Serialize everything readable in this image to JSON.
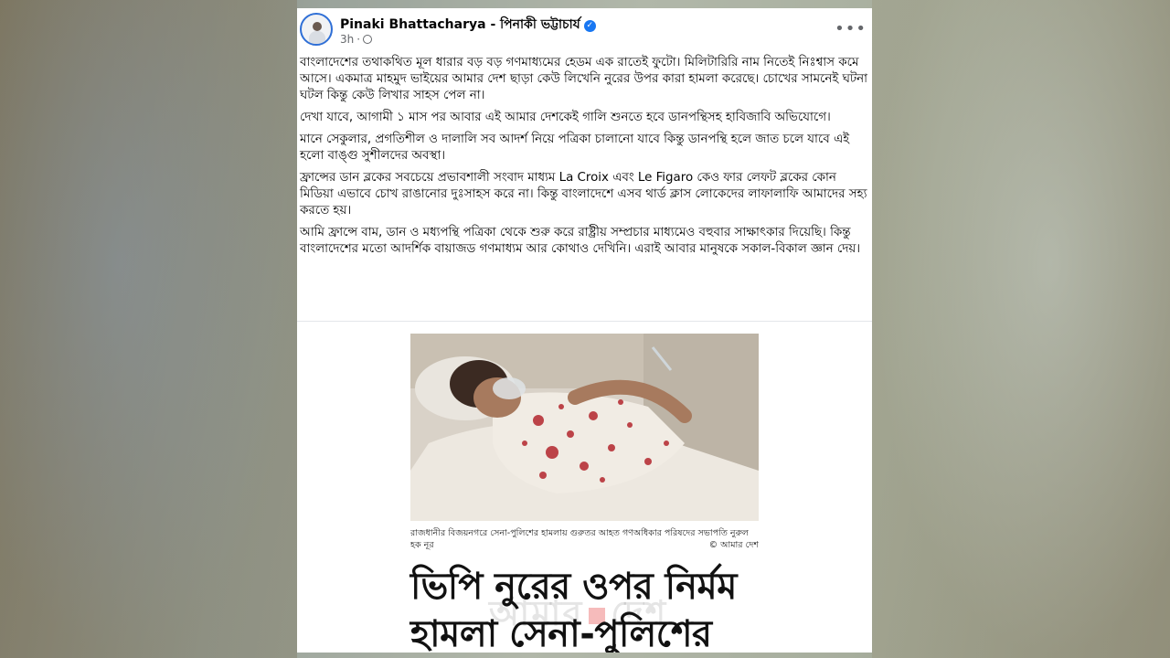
{
  "post": {
    "author": "Pinaki Bhattacharya - পিনাকী ভট্টাচার্য",
    "time": "3h",
    "paragraphs": [
      "বাংলাদেশের তথাকথিত মূল ধারার বড় বড় গণমাধ্যমের হেডম এক রাতেই ফুটো। মিলিটারিরি নাম নিতেই নিঃশ্বাস কমে আসে। একমাত্র মাহমুদ ভাইয়ের আমার দেশ ছাড়া কেউ লিখেনি নুরের উপর কারা হামলা করেছে। চোখের সামনেই ঘটনা ঘটল কিন্তু কেউ লিখার সাহস পেল না।",
      "দেখা যাবে, আগামী ১ মাস পর আবার এই আমার দেশকেই গালি শুনতে হবে ডানপন্থিসহ হাবিজাবি অভিযোগে।",
      "মানে সেকুলার, প্রগতিশীল ও দালালি সব আদর্শ নিয়ে পত্রিকা চালানো যাবে কিন্তু ডানপন্থি হলে জাত চলে যাবে এই হলো বাঙ্গু সুশীলদের অবস্থা।",
      "ফ্রান্সের ডান ব্লকের সবচেয়ে প্রভাবশালী সংবাদ মাধ্যম La Croix এবং Le Figaro কেও ফার লেফট ব্লকের কোন মিডিয়া এভাবে চোখ রাঙানোর দুঃসাহস করে না। কিন্তু বাংলাদেশে এসব থার্ড ক্লাস লোকেদের লাফালাফি আমাদের সহ্য করতে হয়।",
      "আমি ফ্রান্সে বাম, ডান ও মধ্যপন্থি পত্রিকা থেকে শুরু করে রাষ্ট্রীয় সম্প্রচার মাধ্যমেও বহুবার সাক্ষাৎকার দিয়েছি। কিন্তু বাংলাদেশের মতো আদর্শিক বায়াজড গণমাধ্যম আর কোথাও দেখিনি। এরাই আবার মানুষকে সকাল-বিকাল জ্ঞান দেয়।"
    ]
  },
  "newspaper": {
    "caption": "রাজধানীর বিজয়নগরে সেনা-পুলিশের হামলায় গুরুতর আহত গণঅধিকার পরিষদের সভাপতি নুরুল হক নূর",
    "credit": "© আমার দেশ",
    "headline_line1": "ভিপি নুরের ওপর নির্মম",
    "headline_line2": "হামলা সেনা-পুলিশের",
    "watermark_left": "আমার",
    "watermark_right": "দেশ"
  },
  "icons": {
    "verified": "verified-badge-icon",
    "audience": "globe-icon",
    "more": "more-options-icon"
  },
  "colors": {
    "verified": "#1877f2",
    "meta": "#65676b"
  }
}
